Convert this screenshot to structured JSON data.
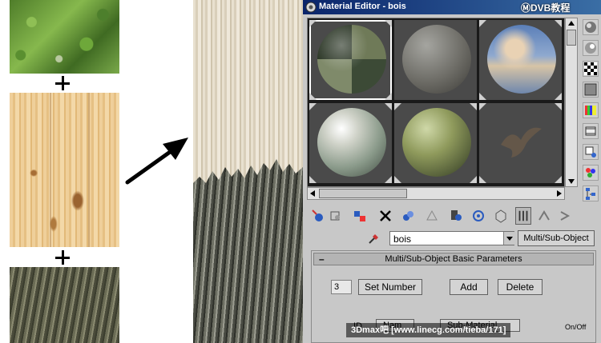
{
  "window": {
    "title": "Material Editor - bois",
    "watermark_logo": "ⓂDVB教程"
  },
  "material_slots": [
    {
      "slot": 1,
      "icon": "multi-sub-checker-sphere",
      "active": true
    },
    {
      "slot": 2,
      "icon": "grey-stone-sphere",
      "active": false
    },
    {
      "slot": 3,
      "icon": "sky-sphere",
      "active": false
    },
    {
      "slot": 4,
      "icon": "marble-sphere",
      "active": false
    },
    {
      "slot": 5,
      "icon": "moss-sphere",
      "active": false
    },
    {
      "slot": 6,
      "icon": "bird-decal",
      "active": false
    }
  ],
  "toolbar": {
    "icons": [
      "get-material-icon",
      "put-to-scene-icon",
      "assign-material-icon",
      "reset-icon",
      "make-copy-icon",
      "make-unique-icon",
      "put-to-library-icon",
      "material-effects-channel-icon",
      "show-map-icon",
      "show-end-result-icon",
      "go-to-parent-icon",
      "go-forward-sibling-icon"
    ]
  },
  "material": {
    "name": "bois",
    "type_button": "Multi/Sub-Object"
  },
  "rollout": {
    "title": "Multi/Sub-Object Basic Parameters",
    "number_value": "3",
    "set_number": "Set Number",
    "add": "Add",
    "delete": "Delete",
    "col_id": "ID",
    "col_name": "Nam",
    "col_sub": "Sub-Material",
    "col_onoff": "On/Off"
  },
  "bottom_watermark": "3Dmax吧 [www.linecg.com/tieba/171]",
  "colors": {
    "titlebar_start": "#0a246a",
    "titlebar_end": "#3a6ea5",
    "panel": "#c8c8c8"
  }
}
